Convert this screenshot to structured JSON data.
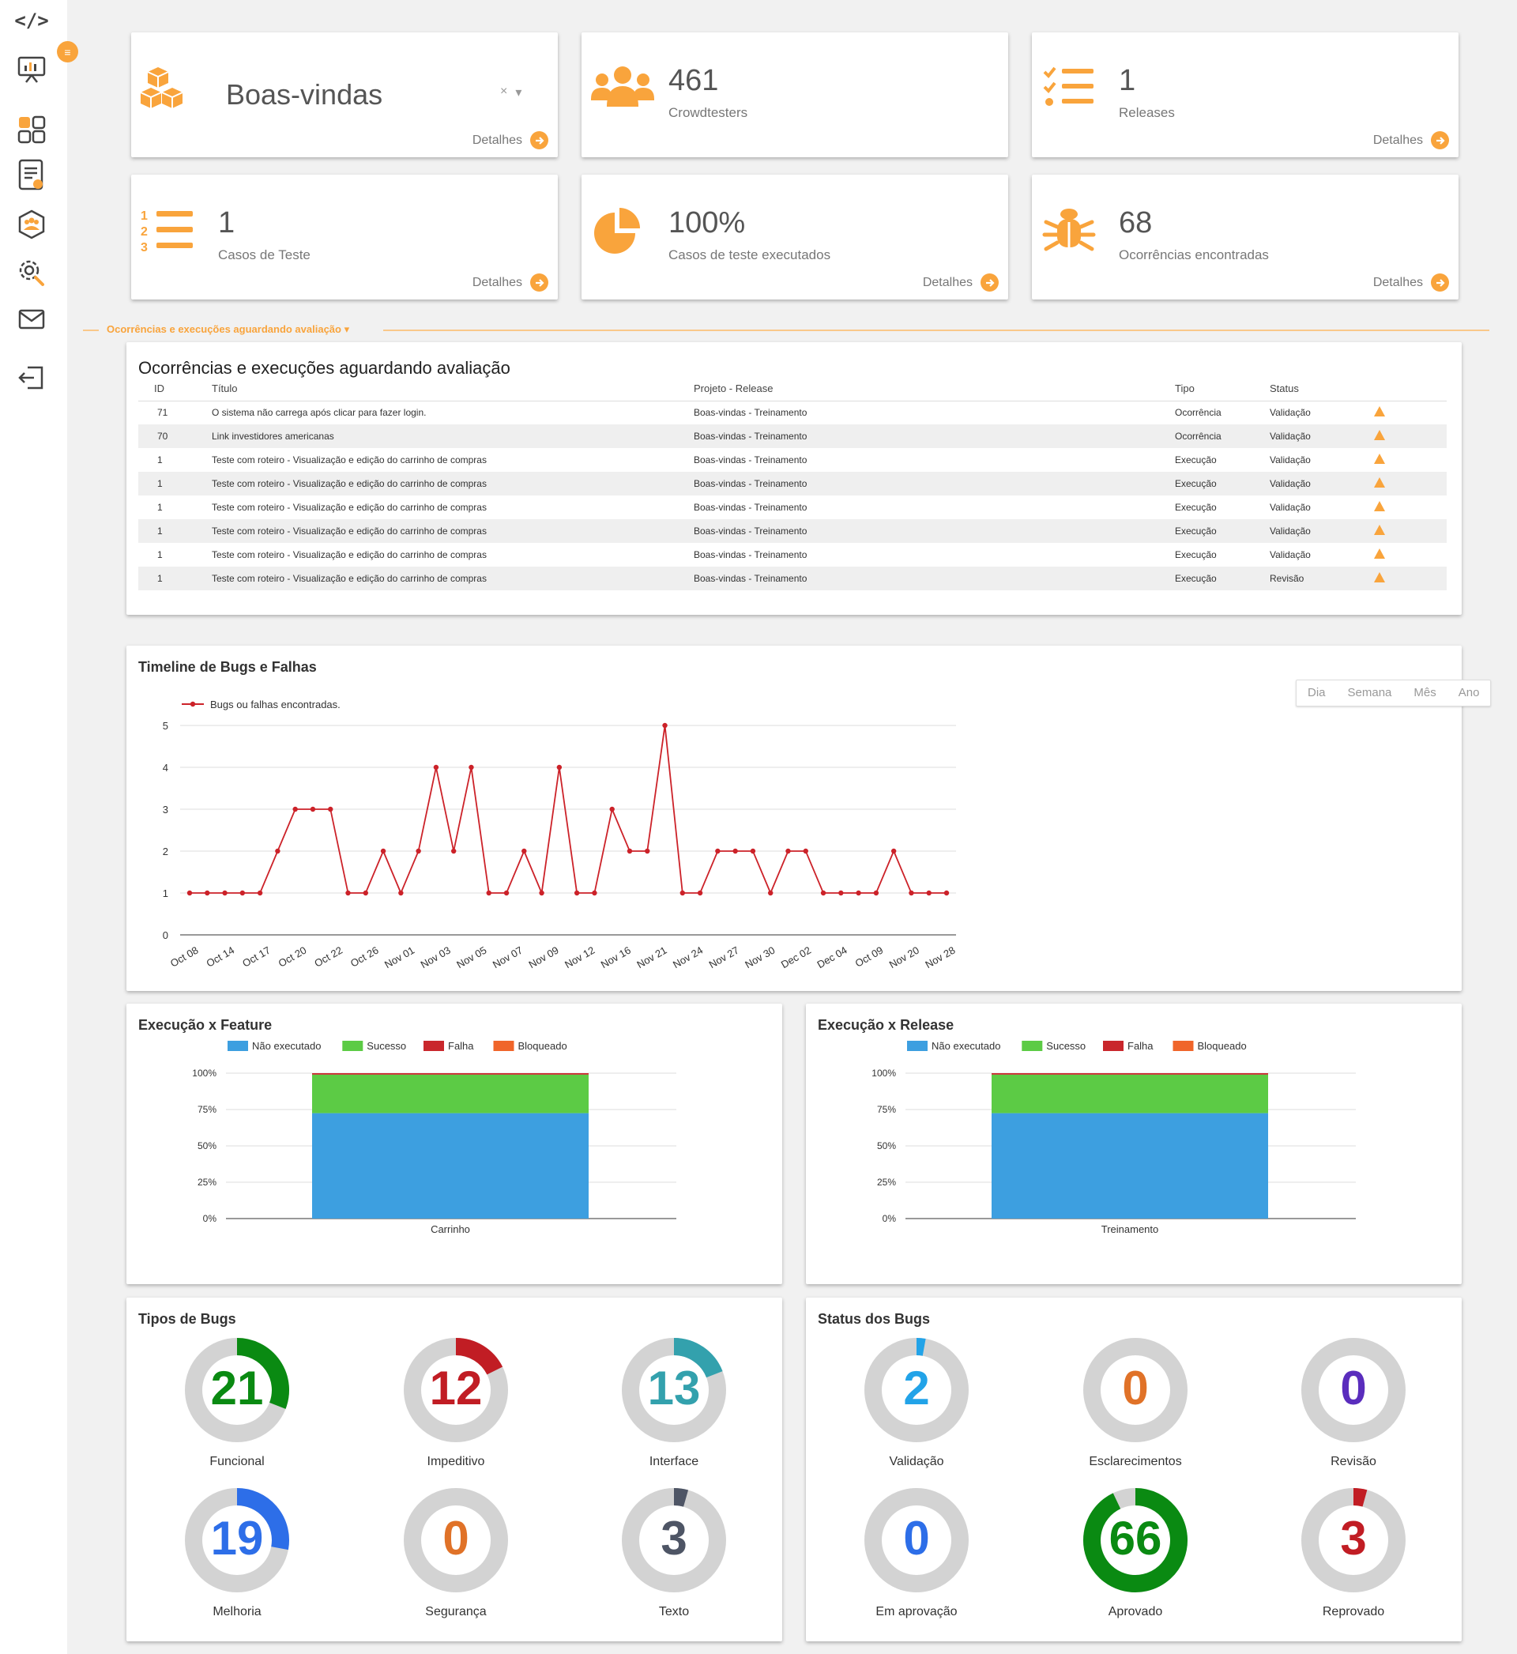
{
  "sidebar": {
    "logo": "</>",
    "notif_count": "≡",
    "items": [
      {
        "name": "dashboard-icon"
      },
      {
        "name": "apps-grid-icon"
      },
      {
        "name": "report-icon"
      },
      {
        "name": "team-icon"
      },
      {
        "name": "settings-icon"
      },
      {
        "name": "mail-icon"
      },
      {
        "name": "logout-icon"
      }
    ]
  },
  "stats": {
    "welcome": {
      "title": "Boas-vindas",
      "clear": "×",
      "caret": "▾",
      "details": "Detalhes"
    },
    "crowdtesters": {
      "number": "461",
      "label": "Crowdtesters"
    },
    "releases": {
      "number": "1",
      "label": "Releases",
      "details": "Detalhes"
    },
    "test_cases": {
      "number": "1",
      "label": "Casos de Teste",
      "details": "Detalhes"
    },
    "executed": {
      "number": "100%",
      "label": "Casos de teste executados",
      "details": "Detalhes"
    },
    "occurrences": {
      "number": "68",
      "label": "Ocorrências encontradas",
      "details": "Detalhes"
    }
  },
  "section": {
    "label": "Ocorrências e execuções aguardando avaliação"
  },
  "pending": {
    "title": "Ocorrências e execuções aguardando avaliação",
    "columns": [
      "ID",
      "Título",
      "Projeto - Release",
      "Tipo",
      "Status"
    ],
    "rows": [
      {
        "id": "71",
        "title": "O sistema não carrega após clicar para fazer login.",
        "project": "Boas-vindas - Treinamento",
        "type": "Ocorrência",
        "status": "Validação"
      },
      {
        "id": "70",
        "title": "Link investidores americanas",
        "project": "Boas-vindas - Treinamento",
        "type": "Ocorrência",
        "status": "Validação"
      },
      {
        "id": "1",
        "title": "Teste com roteiro - Visualização e edição do carrinho de compras",
        "project": "Boas-vindas - Treinamento",
        "type": "Execução",
        "status": "Validação"
      },
      {
        "id": "1",
        "title": "Teste com roteiro - Visualização e edição do carrinho de compras",
        "project": "Boas-vindas - Treinamento",
        "type": "Execução",
        "status": "Validação"
      },
      {
        "id": "1",
        "title": "Teste com roteiro - Visualização e edição do carrinho de compras",
        "project": "Boas-vindas - Treinamento",
        "type": "Execução",
        "status": "Validação"
      },
      {
        "id": "1",
        "title": "Teste com roteiro - Visualização e edição do carrinho de compras",
        "project": "Boas-vindas - Treinamento",
        "type": "Execução",
        "status": "Validação"
      },
      {
        "id": "1",
        "title": "Teste com roteiro - Visualização e edição do carrinho de compras",
        "project": "Boas-vindas - Treinamento",
        "type": "Execução",
        "status": "Validação"
      },
      {
        "id": "1",
        "title": "Teste com roteiro - Visualização e edição do carrinho de compras",
        "project": "Boas-vindas - Treinamento",
        "type": "Execução",
        "status": "Revisão"
      }
    ]
  },
  "timeline": {
    "title": "Timeline de Bugs e Falhas",
    "range_buttons": [
      "Dia",
      "Semana",
      "Mês",
      "Ano"
    ]
  },
  "exec_feature": {
    "title": "Execução x Feature"
  },
  "exec_release": {
    "title": "Execução x Release"
  },
  "bug_types": {
    "title": "Tipos de Bugs"
  },
  "bug_status": {
    "title": "Status dos Bugs"
  },
  "chart_data": [
    {
      "type": "line",
      "title": "Timeline de Bugs e Falhas",
      "legend": "Bugs ou falhas encontradas.",
      "legend_position": "top-left",
      "series_color": "#cc2229",
      "ylim": [
        0,
        5
      ],
      "y_ticks": [
        0,
        1,
        2,
        3,
        4,
        5
      ],
      "grid": true,
      "x_tick_labels": [
        "Oct 08",
        "Oct 14",
        "Oct 17",
        "Oct 20",
        "Oct 22",
        "Oct 26",
        "Nov 01",
        "Nov 03",
        "Nov 05",
        "Nov 07",
        "Nov 09",
        "Nov 12",
        "Nov 16",
        "Nov 21",
        "Nov 24",
        "Nov 27",
        "Nov 30",
        "Dec 02",
        "Dec 04",
        "Oct 09",
        "Nov 20",
        "Nov 28"
      ],
      "values": [
        1,
        1,
        1,
        1,
        1,
        2,
        3,
        3,
        3,
        1,
        1,
        2,
        1,
        2,
        4,
        2,
        4,
        1,
        1,
        2,
        1,
        4,
        1,
        1,
        3,
        2,
        2,
        5,
        1,
        1,
        2,
        2,
        2,
        1,
        2,
        2,
        1,
        1,
        1,
        1,
        2,
        1,
        1,
        1
      ]
    },
    {
      "type": "bar",
      "stacked": "percent",
      "title": "Execução x Feature",
      "categories": [
        "Carrinho"
      ],
      "y_tick_labels": [
        "100%",
        "75%",
        "50%",
        "25%",
        "0%"
      ],
      "legend_position": "top",
      "series": [
        {
          "name": "Não executado",
          "color": "#3d9fe0",
          "values": [
            72.5
          ]
        },
        {
          "name": "Sucesso",
          "color": "#5ccb45",
          "values": [
            26.5
          ]
        },
        {
          "name": "Falha",
          "color": "#c9272c",
          "values": [
            1
          ]
        },
        {
          "name": "Bloqueado",
          "color": "#f0652a",
          "values": [
            0
          ]
        }
      ]
    },
    {
      "type": "bar",
      "stacked": "percent",
      "title": "Execução x Release",
      "categories": [
        "Treinamento"
      ],
      "y_tick_labels": [
        "100%",
        "75%",
        "50%",
        "25%",
        "0%"
      ],
      "legend_position": "top",
      "series": [
        {
          "name": "Não executado",
          "color": "#3d9fe0",
          "values": [
            72.5
          ]
        },
        {
          "name": "Sucesso",
          "color": "#5ccb45",
          "values": [
            26.5
          ]
        },
        {
          "name": "Falha",
          "color": "#c9272c",
          "values": [
            1
          ]
        },
        {
          "name": "Bloqueado",
          "color": "#f0652a",
          "values": [
            0
          ]
        }
      ]
    },
    {
      "type": "pie",
      "title": "Tipos de Bugs",
      "total": 68,
      "items": [
        {
          "label": "Funcional",
          "value": 21,
          "color": "#0a8a12"
        },
        {
          "label": "Impeditivo",
          "value": 12,
          "color": "#c11d24"
        },
        {
          "label": "Interface",
          "value": 13,
          "color": "#33a1ad"
        },
        {
          "label": "Melhoria",
          "value": 19,
          "color": "#2d6ee8"
        },
        {
          "label": "Segurança",
          "value": 0,
          "color": "#e07228"
        },
        {
          "label": "Texto",
          "value": 3,
          "color": "#4e5565"
        }
      ]
    },
    {
      "type": "pie",
      "title": "Status dos Bugs",
      "total": 71,
      "items": [
        {
          "label": "Validação",
          "value": 2,
          "color": "#22a3e8"
        },
        {
          "label": "Esclarecimentos",
          "value": 0,
          "color": "#e07228"
        },
        {
          "label": "Revisão",
          "value": 0,
          "color": "#5a2dbd"
        },
        {
          "label": "Em aprovação",
          "value": 0,
          "color": "#2d6ee8"
        },
        {
          "label": "Aprovado",
          "value": 66,
          "color": "#0a8a12"
        },
        {
          "label": "Reprovado",
          "value": 3,
          "color": "#c11d24"
        }
      ]
    }
  ]
}
